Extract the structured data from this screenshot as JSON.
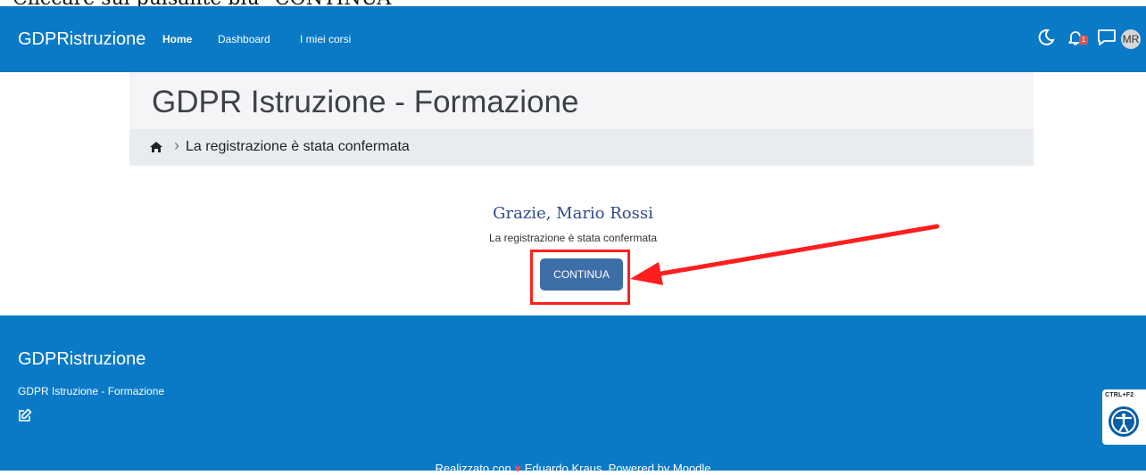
{
  "caption": "Cliccare sul pulsante blu \"CONTINUA\"",
  "navbar": {
    "brand": "GDPRistruzione",
    "links": [
      "Home",
      "Dashboard",
      "I miei corsi"
    ],
    "notification_count": "1",
    "avatar_initials": "MR",
    "icons": [
      "moon-icon",
      "bell-icon",
      "chat-icon"
    ],
    "bg_color": "#0a7ac7"
  },
  "header": {
    "title": "GDPR Istruzione - Formazione"
  },
  "breadcrumb": {
    "home_icon": "home-icon",
    "current": "La registrazione è stata confermata"
  },
  "main": {
    "greeting": "Grazie, Mario Rossi",
    "message": "La registrazione è stata confermata",
    "continue_label": "CONTINUA",
    "button_color": "#3e6ea8",
    "highlight_color": "#ff1e1e"
  },
  "footer": {
    "brand": "GDPRistruzione",
    "subtitle": "GDPR Istruzione - Formazione",
    "edit_icon": "edit-icon",
    "credits_prefix": "Realizzato con",
    "credits_suffix": "Eduardo Kraus. Powered by Moodle"
  },
  "accessibility": {
    "shortcut": "CTRL+F2",
    "icon": "accessibility-icon"
  }
}
